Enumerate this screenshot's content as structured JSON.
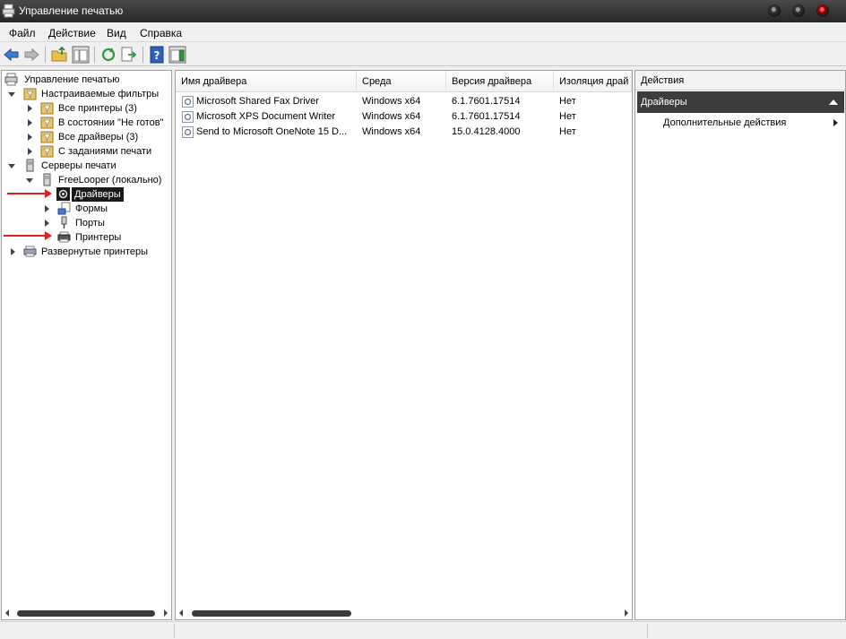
{
  "window": {
    "title": "Управление печатью",
    "controls": [
      "minimize",
      "maximize",
      "close"
    ]
  },
  "menu": [
    "Файл",
    "Действие",
    "Вид",
    "Справка"
  ],
  "toolbar": {
    "buttons": [
      "back-icon",
      "forward-icon",
      "up-folder-icon",
      "show-hide-tree-icon",
      "refresh-icon",
      "export-list-icon",
      "help-icon",
      "show-hide-action-pane-icon"
    ]
  },
  "tree": {
    "root": "Управление печатью",
    "custom_filters": {
      "label": "Настраиваемые фильтры",
      "items": [
        "Все принтеры (3)",
        "В состоянии \"Не готов\"",
        "Все драйверы (3)",
        "С заданиями печати"
      ]
    },
    "servers": {
      "label": "Серверы печати",
      "server": "FreeLooper (локально)",
      "children": [
        "Драйверы",
        "Формы",
        "Порты",
        "Принтеры"
      ]
    },
    "deployed": "Развернутые принтеры"
  },
  "list": {
    "columns": [
      "Имя драйвера",
      "Среда",
      "Версия драйвера",
      "Изоляция драй"
    ],
    "rows": [
      [
        "Microsoft Shared Fax Driver",
        "Windows x64",
        "6.1.7601.17514",
        "Нет"
      ],
      [
        "Microsoft XPS Document Writer",
        "Windows x64",
        "6.1.7601.17514",
        "Нет"
      ],
      [
        "Send to Microsoft OneNote 15 D...",
        "Windows x64",
        "15.0.4128.4000",
        "Нет"
      ]
    ]
  },
  "actions": {
    "header": "Действия",
    "group": "Драйверы",
    "items": [
      "Дополнительные действия"
    ]
  },
  "colors": {
    "titlebar": "#262626",
    "selection": "#1a1a1a",
    "annotation_arrow": "#e0201a",
    "actions_group_bg": "#3c3c3c"
  }
}
